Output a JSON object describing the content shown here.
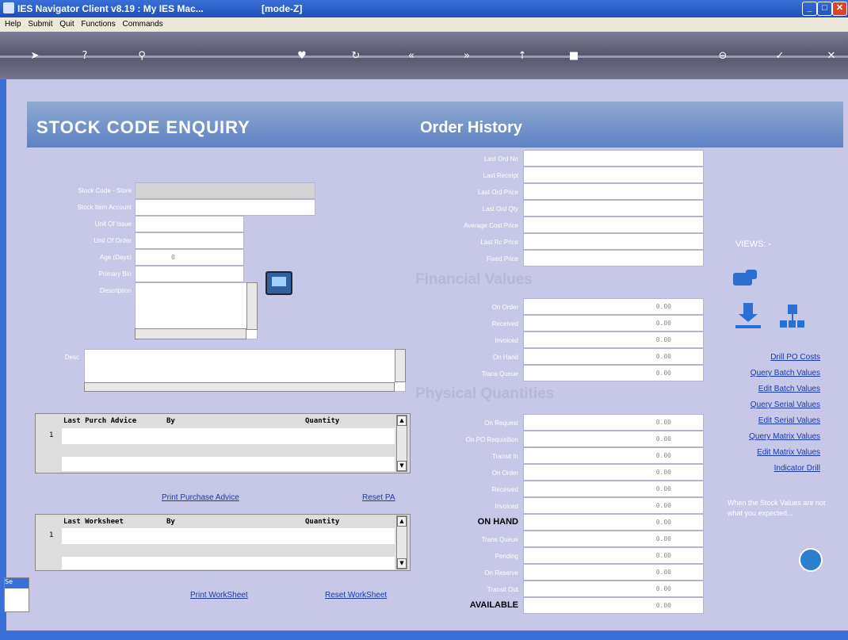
{
  "window": {
    "title": "IES Navigator Client v8.19 : My IES  Mac...",
    "mode": "[mode-Z]"
  },
  "menu": [
    "Help",
    "Submit",
    "Quit",
    "Functions",
    "Commands"
  ],
  "toolbar_icons": [
    "send-icon",
    "help-icon",
    "search-icon",
    "heart-icon",
    "refresh-icon",
    "rewind-icon",
    "forward-icon",
    "up-icon",
    "stop-icon",
    "cancel-icon",
    "ok-icon",
    "close-icon"
  ],
  "headings": {
    "stock_code_enquiry": "STOCK  CODE  ENQUIRY",
    "order_history": "Order History",
    "financial_values": "Financial Values",
    "physical_quantities": "Physical Quantities",
    "views": "VIEWS: -"
  },
  "stock_fields": [
    {
      "label": "Stock Code - Store",
      "value": ""
    },
    {
      "label": "Stock Item Account",
      "value": ""
    },
    {
      "label": "Unit Of Issue",
      "value": ""
    },
    {
      "label": "Unit Of Order",
      "value": ""
    },
    {
      "label": "Age (Days)",
      "value": "0"
    },
    {
      "label": "Primary Bin",
      "value": ""
    },
    {
      "label": "Description",
      "value": ""
    }
  ],
  "desc_label": "Desc",
  "order_history": [
    {
      "label": "Last Ord No",
      "value": ""
    },
    {
      "label": "Last Receipt",
      "value": ""
    },
    {
      "label": "Last Ord Price",
      "value": ""
    },
    {
      "label": "Last Ord Qty",
      "value": ""
    },
    {
      "label": "Average Cost Price",
      "value": ""
    },
    {
      "label": "Last Rc Price",
      "value": ""
    },
    {
      "label": "Fixed Price",
      "value": ""
    }
  ],
  "financial_values": [
    {
      "label": "On Order",
      "value": "0.00"
    },
    {
      "label": "Received",
      "value": "0.00"
    },
    {
      "label": "Invoiced",
      "value": "0.00"
    },
    {
      "label": "On Hand",
      "value": "0.00"
    },
    {
      "label": "Trans Queue",
      "value": "0.00"
    }
  ],
  "physical_quantities": [
    {
      "label": "On Request",
      "value": "0.00"
    },
    {
      "label": "On PO Requisition",
      "value": "0.00"
    },
    {
      "label": "Transit In",
      "value": "0.00"
    },
    {
      "label": "On Order",
      "value": "0.00"
    },
    {
      "label": "Received",
      "value": "0.00"
    },
    {
      "label": "Invoiced",
      "value": "0.00"
    },
    {
      "label": "ON HAND",
      "value": "0.00"
    },
    {
      "label": "Trans Queue",
      "value": "0.00"
    },
    {
      "label": "Pending",
      "value": "0.00"
    },
    {
      "label": "On Reserve",
      "value": "0.00"
    },
    {
      "label": "Transit Out",
      "value": "0.00"
    },
    {
      "label": "AVAILABLE",
      "value": "0.00"
    }
  ],
  "purch_advice_grid": {
    "columns": [
      "Last Purch Advice",
      "By",
      "Quantity"
    ],
    "row_num": "1"
  },
  "worksheet_grid": {
    "columns": [
      "Last Worksheet",
      "By",
      "Quantity"
    ],
    "row_num": "1"
  },
  "links": {
    "print_purchase_advice": "Print Purchase Advice",
    "reset_pa": "Reset PA",
    "print_worksheet": "Print WorkSheet",
    "reset_worksheet": "Reset WorkSheet"
  },
  "views_links": [
    "Drill PO Costs",
    "Query Batch Values",
    "Edit Batch Values",
    "Query Serial Values",
    "Edit Serial Values",
    "Query Matrix Values",
    "Edit Matrix Values",
    "Indicator Drill"
  ],
  "hint_text": "When the Stock Values are not what you expected...",
  "status_tab": "Se",
  "colors": {
    "title_bar": "#1f4fb8",
    "banner": "#5d82c4",
    "background": "#c7c7e8",
    "link": "#1a3aa8"
  }
}
